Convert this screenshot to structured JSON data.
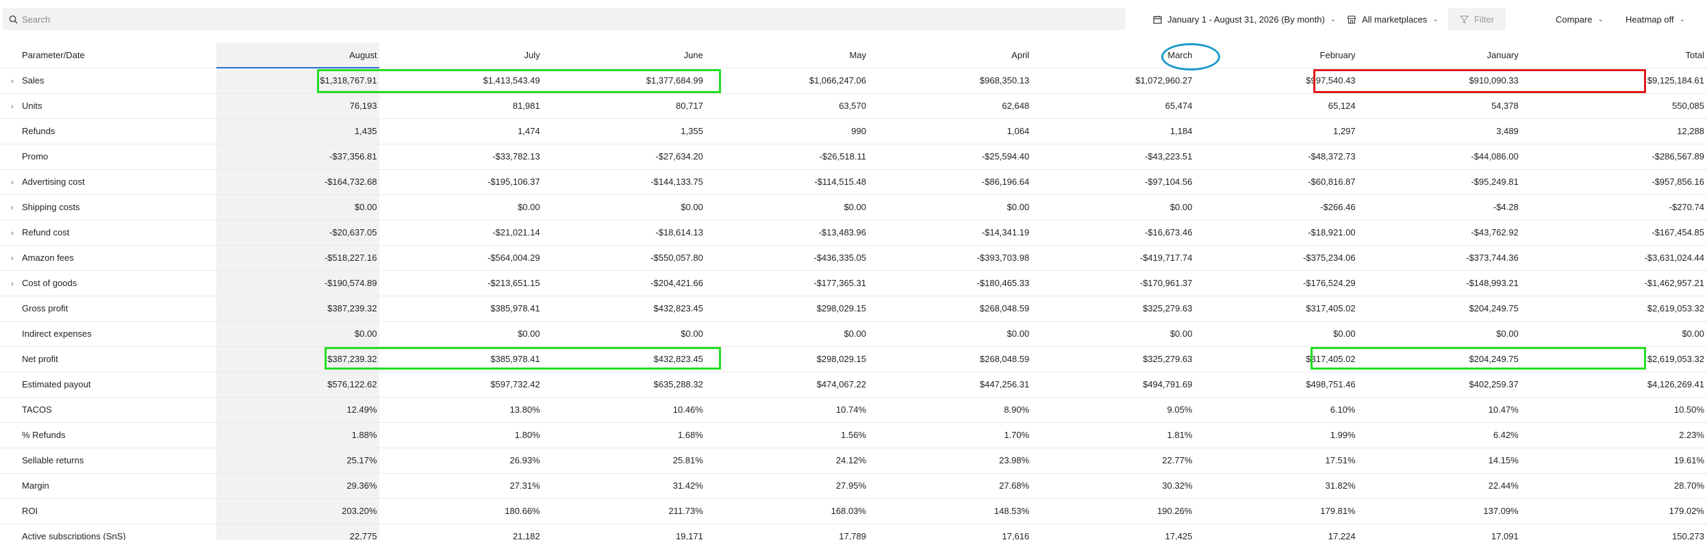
{
  "toolbar": {
    "search_placeholder": "Search",
    "date_range": "January 1 - August 31, 2026 (By month)",
    "marketplaces": "All marketplaces",
    "filter": "Filter",
    "compare": "Compare",
    "heatmap": "Heatmap off"
  },
  "table": {
    "header": [
      "Parameter/Date",
      "August",
      "July",
      "June",
      "May",
      "April",
      "March",
      "February",
      "January",
      "Total"
    ],
    "rows": [
      {
        "label": "Sales",
        "expandable": true,
        "values": [
          "$1,318,767.91",
          "$1,413,543.49",
          "$1,377,684.99",
          "$1,066,247.06",
          "$968,350.13",
          "$1,072,960.27",
          "$997,540.43",
          "$910,090.33",
          "$9,125,184.61"
        ]
      },
      {
        "label": "Units",
        "expandable": true,
        "values": [
          "76,193",
          "81,981",
          "80,717",
          "63,570",
          "62,648",
          "65,474",
          "65,124",
          "54,378",
          "550,085"
        ]
      },
      {
        "label": "Refunds",
        "expandable": false,
        "values": [
          "1,435",
          "1,474",
          "1,355",
          "990",
          "1,064",
          "1,184",
          "1,297",
          "3,489",
          "12,288"
        ]
      },
      {
        "label": "Promo",
        "expandable": false,
        "values": [
          "-$37,356.81",
          "-$33,782.13",
          "-$27,634.20",
          "-$26,518.11",
          "-$25,594.40",
          "-$43,223.51",
          "-$48,372.73",
          "-$44,086.00",
          "-$286,567.89"
        ]
      },
      {
        "label": "Advertising cost",
        "expandable": true,
        "values": [
          "-$164,732.68",
          "-$195,106.37",
          "-$144,133.75",
          "-$114,515.48",
          "-$86,196.64",
          "-$97,104.56",
          "-$60,816.87",
          "-$95,249.81",
          "-$957,856.16"
        ]
      },
      {
        "label": "Shipping costs",
        "expandable": true,
        "values": [
          "$0.00",
          "$0.00",
          "$0.00",
          "$0.00",
          "$0.00",
          "$0.00",
          "-$266.46",
          "-$4.28",
          "-$270.74"
        ]
      },
      {
        "label": "Refund cost",
        "expandable": true,
        "values": [
          "-$20,637.05",
          "-$21,021.14",
          "-$18,614.13",
          "-$13,483.96",
          "-$14,341.19",
          "-$16,673.46",
          "-$18,921.00",
          "-$43,762.92",
          "-$167,454.85"
        ]
      },
      {
        "label": "Amazon fees",
        "expandable": true,
        "values": [
          "-$518,227.16",
          "-$564,004.29",
          "-$550,057.80",
          "-$436,335.05",
          "-$393,703.98",
          "-$419,717.74",
          "-$375,234.06",
          "-$373,744.36",
          "-$3,631,024.44"
        ]
      },
      {
        "label": "Cost of goods",
        "expandable": true,
        "values": [
          "-$190,574.89",
          "-$213,651.15",
          "-$204,421.66",
          "-$177,365.31",
          "-$180,465.33",
          "-$170,961.37",
          "-$176,524.29",
          "-$148,993.21",
          "-$1,462,957.21"
        ]
      },
      {
        "label": "Gross profit",
        "expandable": false,
        "values": [
          "$387,239.32",
          "$385,978.41",
          "$432,823.45",
          "$298,029.15",
          "$268,048.59",
          "$325,279.63",
          "$317,405.02",
          "$204,249.75",
          "$2,619,053.32"
        ]
      },
      {
        "label": "Indirect expenses",
        "expandable": false,
        "values": [
          "$0.00",
          "$0.00",
          "$0.00",
          "$0.00",
          "$0.00",
          "$0.00",
          "$0.00",
          "$0.00",
          "$0.00"
        ]
      },
      {
        "label": "Net profit",
        "expandable": false,
        "values": [
          "$387,239.32",
          "$385,978.41",
          "$432,823.45",
          "$298,029.15",
          "$268,048.59",
          "$325,279.63",
          "$317,405.02",
          "$204,249.75",
          "$2,619,053.32"
        ]
      },
      {
        "label": "Estimated payout",
        "expandable": false,
        "values": [
          "$576,122.62",
          "$597,732.42",
          "$635,288.32",
          "$474,067.22",
          "$447,256.31",
          "$494,791.69",
          "$498,751.46",
          "$402,259.37",
          "$4,126,269.41"
        ]
      },
      {
        "label": "TACOS",
        "expandable": false,
        "values": [
          "12.49%",
          "13.80%",
          "10.46%",
          "10.74%",
          "8.90%",
          "9.05%",
          "6.10%",
          "10.47%",
          "10.50%"
        ]
      },
      {
        "label": "% Refunds",
        "expandable": false,
        "values": [
          "1.88%",
          "1.80%",
          "1.68%",
          "1.56%",
          "1.70%",
          "1.81%",
          "1.99%",
          "6.42%",
          "2.23%"
        ]
      },
      {
        "label": "Sellable returns",
        "expandable": false,
        "values": [
          "25.17%",
          "26.93%",
          "25.81%",
          "24.12%",
          "23.98%",
          "22.77%",
          "17.51%",
          "14.15%",
          "19.61%"
        ]
      },
      {
        "label": "Margin",
        "expandable": false,
        "values": [
          "29.36%",
          "27.31%",
          "31.42%",
          "27.95%",
          "27.68%",
          "30.32%",
          "31.82%",
          "22.44%",
          "28.70%"
        ]
      },
      {
        "label": "ROI",
        "expandable": false,
        "values": [
          "203.20%",
          "180.66%",
          "211.73%",
          "168.03%",
          "148.53%",
          "190.26%",
          "179.81%",
          "137.09%",
          "179.02%"
        ]
      },
      {
        "label": "Active subscriptions (SnS)",
        "expandable": false,
        "values": [
          "22,775",
          "21,182",
          "19,171",
          "17,789",
          "17,616",
          "17,425",
          "17,224",
          "17,091",
          "150,273"
        ]
      }
    ]
  },
  "annotation_colors": {
    "green": "#22dd22",
    "red": "#e01818",
    "blue": "#1a9bc9"
  }
}
